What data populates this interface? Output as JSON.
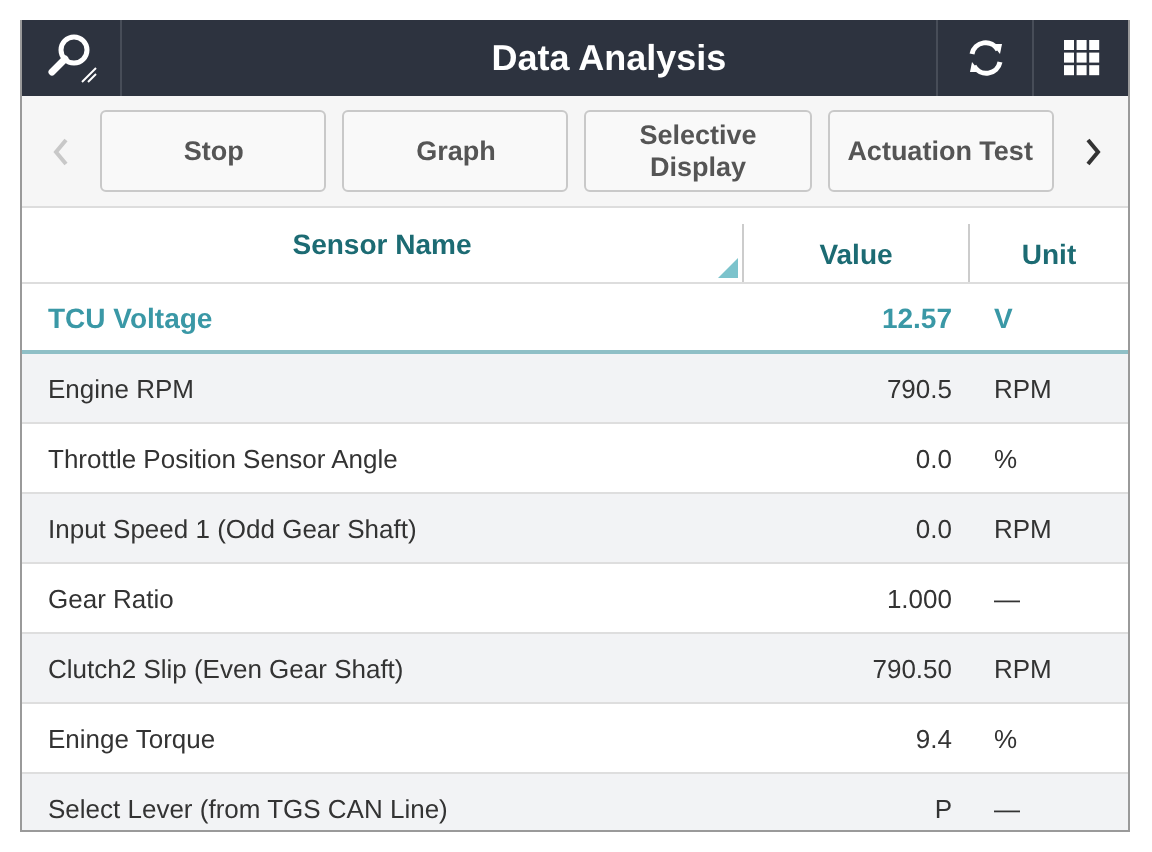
{
  "window": {
    "title": "Data Analysis"
  },
  "toolbar": {
    "prev_disabled": true,
    "next_disabled": false,
    "buttons": [
      "Stop",
      "Graph",
      "Selective\nDisplay",
      "Actuation Test"
    ]
  },
  "table": {
    "columns": [
      "Sensor Name",
      "Value",
      "Unit"
    ],
    "rows": [
      {
        "name": "TCU Voltage",
        "value": "12.57",
        "unit": "V",
        "selected": true
      },
      {
        "name": "Engine RPM",
        "value": "790.5",
        "unit": "RPM",
        "selected": false
      },
      {
        "name": "Throttle Position Sensor Angle",
        "value": "0.0",
        "unit": "%",
        "selected": false
      },
      {
        "name": "Input Speed 1 (Odd Gear Shaft)",
        "value": "0.0",
        "unit": "RPM",
        "selected": false
      },
      {
        "name": "Gear Ratio",
        "value": "1.000",
        "unit": "—",
        "selected": false
      },
      {
        "name": "Clutch2 Slip (Even Gear Shaft)",
        "value": "790.50",
        "unit": "RPM",
        "selected": false
      },
      {
        "name": "Eninge Torque",
        "value": "9.4",
        "unit": "%",
        "selected": false
      },
      {
        "name": "Select Lever (from TGS CAN Line)",
        "value": "P",
        "unit": "—",
        "selected": false
      }
    ]
  }
}
